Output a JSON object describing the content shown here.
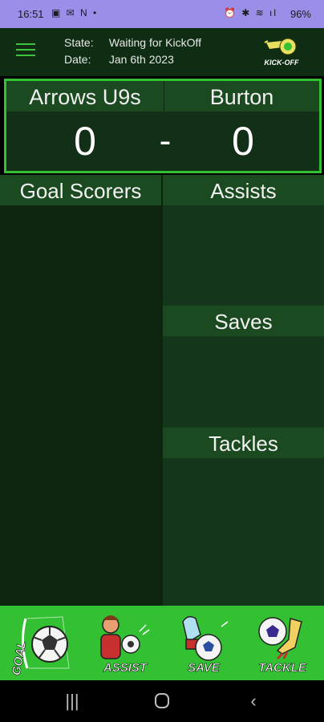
{
  "status_bar": {
    "time": "16:51",
    "left_icons_text": "▣ ✉ N •",
    "right_icons_text": "⏰ ✱ ≋ ıl",
    "battery": "96%"
  },
  "header": {
    "state_label": "State:",
    "state_value": "Waiting for KickOff",
    "date_label": "Date:",
    "date_value": "Jan 6th 2023",
    "kickoff_label": "KICK-OFF"
  },
  "scoreboard": {
    "home_team": "Arrows U9s",
    "away_team": "Burton",
    "home_score": "0",
    "away_score": "0",
    "separator": "-"
  },
  "sections": {
    "goal_scorers": "Goal Scorers",
    "assists": "Assists",
    "saves": "Saves",
    "tackles": "Tackles"
  },
  "actions": {
    "goal": "GOAL",
    "assist": "ASSIST",
    "save": "SAVE",
    "tackle": "TACKLE"
  },
  "colors": {
    "accent_green": "#33c133",
    "dark_green": "#0f2d12",
    "header_green": "#1b4a20",
    "status_bar": "#9b8ee8"
  }
}
